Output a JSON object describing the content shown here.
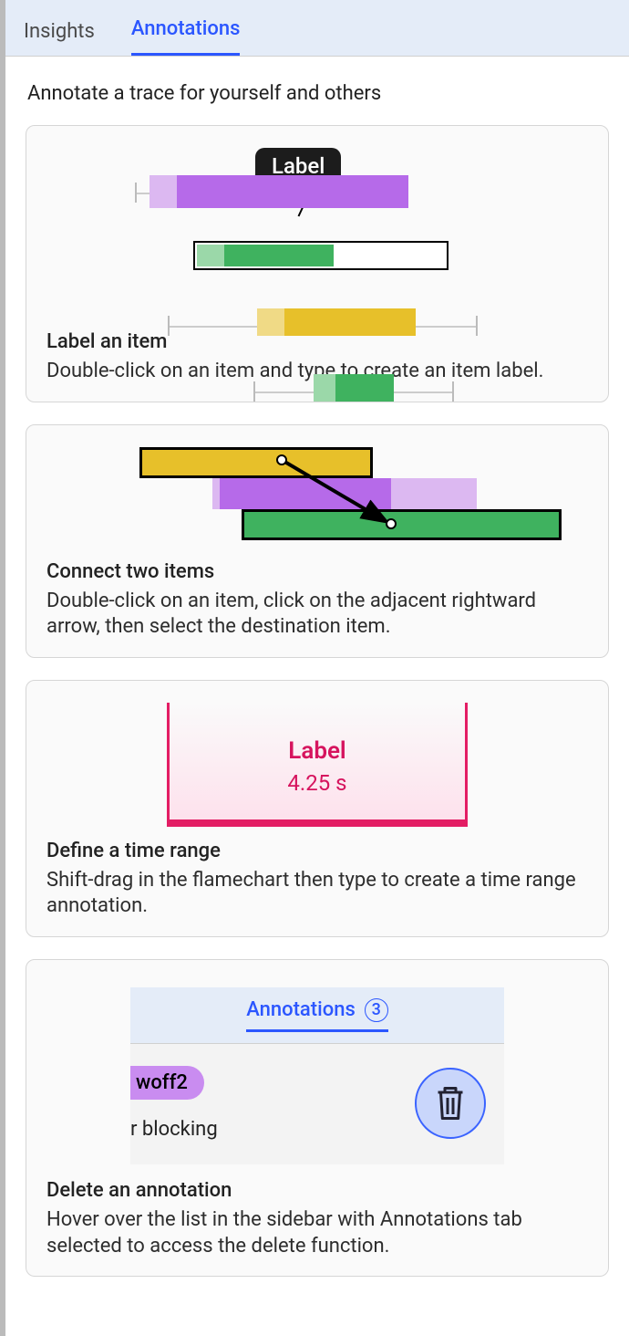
{
  "tabs": {
    "insights_label": "Insights",
    "annotations_label": "Annotations"
  },
  "page_title": "Annotate a trace for yourself and others",
  "card1": {
    "bubble": "Label",
    "title": "Label an item",
    "desc": "Double-click on an item and type to create an item label."
  },
  "card2": {
    "title": "Connect two items",
    "desc": "Double-click on an item, click on the adjacent rightward arrow, then select the destination item."
  },
  "card3": {
    "range_label": "Label",
    "range_time": "4.25 s",
    "title": "Define a time range",
    "desc": "Shift-drag in the flamechart then type to create a time range annotation."
  },
  "card4": {
    "tab_label": "Annotations",
    "tab_count": "3",
    "item_tag": "woff2",
    "item_text": "r blocking",
    "title": "Delete an annotation",
    "desc": "Hover over the list in the sidebar with Annotations tab selected to access the delete function."
  }
}
